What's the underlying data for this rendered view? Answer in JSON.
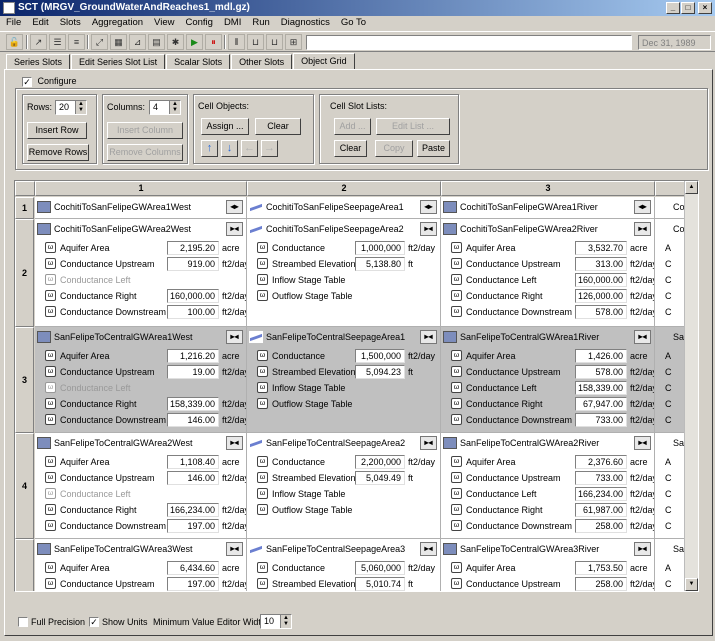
{
  "window": {
    "title": "SCT  (MRGV_GroundWaterAndReaches1_mdl.gz)",
    "min": "_",
    "max": "□",
    "close": "×"
  },
  "menu": [
    "File",
    "Edit",
    "Slots",
    "Aggregation",
    "View",
    "Config",
    "DMI",
    "Run",
    "Diagnostics",
    "Go To"
  ],
  "toolbar": {
    "date": "Dec 31, 1989"
  },
  "tabs": [
    "Series Slots",
    "Edit Series Slot List",
    "Scalar Slots",
    "Other Slots",
    "Object Grid"
  ],
  "configure": {
    "label": "Configure",
    "checked": true,
    "rows_label": "Rows:",
    "rows_value": "20",
    "insert_row": "Insert Row",
    "remove_rows": "Remove Rows",
    "columns_label": "Columns:",
    "columns_value": "4",
    "insert_column": "Insert Column",
    "remove_columns": "Remove Columns",
    "cell_objects_label": "Cell Objects:",
    "assign": "Assign ...",
    "clear": "Clear",
    "cell_slot_lists_label": "Cell Slot Lists:",
    "add": "Add ...",
    "edit_list": "Edit List ...",
    "clear2": "Clear",
    "copy": "Copy",
    "paste": "Paste"
  },
  "grid": {
    "columns": [
      "1",
      "2",
      "3"
    ],
    "rows": [
      "1",
      "2",
      "3",
      "4"
    ],
    "cells": [
      [
        {
          "name": "CochitiToSanFelipeGWArea1West",
          "type": "gw",
          "slots": []
        },
        {
          "name": "CochitiToSanFelipeSeepageArea1",
          "type": "sp",
          "slots": []
        },
        {
          "name": "CochitiToSanFelipeGWArea1River",
          "type": "gw",
          "slots": []
        }
      ],
      [
        {
          "name": "CochitiToSanFelipeGWArea2West",
          "type": "gw",
          "slots": [
            {
              "name": "Aquifer Area",
              "value": "2,195.20",
              "unit": "acre"
            },
            {
              "name": "Conductance Upstream",
              "value": "919.00",
              "unit": "ft2/day"
            },
            {
              "name": "Conductance Left",
              "value": "",
              "unit": "",
              "disabled": true
            },
            {
              "name": "Conductance Right",
              "value": "160,000.00",
              "unit": "ft2/day"
            },
            {
              "name": "Conductance Downstream",
              "value": "100.00",
              "unit": "ft2/day"
            }
          ]
        },
        {
          "name": "CochitiToSanFelipeSeepageArea2",
          "type": "sp",
          "slots": [
            {
              "name": "Conductance",
              "value": "1,000,000",
              "unit": "ft2/day"
            },
            {
              "name": "Streambed Elevation",
              "value": "5,138.80",
              "unit": "ft"
            },
            {
              "name": "Inflow Stage Table",
              "value": "",
              "unit": ""
            },
            {
              "name": "Outflow Stage Table",
              "value": "",
              "unit": ""
            }
          ]
        },
        {
          "name": "CochitiToSanFelipeGWArea2River",
          "type": "gw",
          "slots": [
            {
              "name": "Aquifer Area",
              "value": "3,532.70",
              "unit": "acre"
            },
            {
              "name": "Conductance Upstream",
              "value": "313.00",
              "unit": "ft2/day"
            },
            {
              "name": "Conductance Left",
              "value": "160,000.00",
              "unit": "ft2/day"
            },
            {
              "name": "Conductance Right",
              "value": "126,000.00",
              "unit": "ft2/day"
            },
            {
              "name": "Conductance Downstream",
              "value": "578.00",
              "unit": "ft2/day"
            }
          ]
        }
      ],
      [
        {
          "name": "SanFelipeToCentralGWArea1West",
          "type": "gw",
          "slots": [
            {
              "name": "Aquifer Area",
              "value": "1,216.20",
              "unit": "acre"
            },
            {
              "name": "Conductance Upstream",
              "value": "19.00",
              "unit": "ft2/day"
            },
            {
              "name": "Conductance Left",
              "value": "",
              "unit": "",
              "disabled": true
            },
            {
              "name": "Conductance Right",
              "value": "158,339.00",
              "unit": "ft2/day"
            },
            {
              "name": "Conductance Downstream",
              "value": "146.00",
              "unit": "ft2/day"
            }
          ]
        },
        {
          "name": "SanFelipeToCentralSeepageArea1",
          "type": "sp",
          "slots": [
            {
              "name": "Conductance",
              "value": "1,500,000",
              "unit": "ft2/day"
            },
            {
              "name": "Streambed Elevation",
              "value": "5,094.23",
              "unit": "ft"
            },
            {
              "name": "Inflow Stage Table",
              "value": "",
              "unit": ""
            },
            {
              "name": "Outflow Stage Table",
              "value": "",
              "unit": ""
            }
          ]
        },
        {
          "name": "SanFelipeToCentralGWArea1River",
          "type": "gw",
          "slots": [
            {
              "name": "Aquifer Area",
              "value": "1,426.00",
              "unit": "acre"
            },
            {
              "name": "Conductance Upstream",
              "value": "578.00",
              "unit": "ft2/day"
            },
            {
              "name": "Conductance Left",
              "value": "158,339.00",
              "unit": "ft2/day"
            },
            {
              "name": "Conductance Right",
              "value": "67,947.00",
              "unit": "ft2/day"
            },
            {
              "name": "Conductance Downstream",
              "value": "733.00",
              "unit": "ft2/day"
            }
          ]
        }
      ],
      [
        {
          "name": "SanFelipeToCentralGWArea2West",
          "type": "gw",
          "slots": [
            {
              "name": "Aquifer Area",
              "value": "1,108.40",
              "unit": "acre"
            },
            {
              "name": "Conductance Upstream",
              "value": "146.00",
              "unit": "ft2/day"
            },
            {
              "name": "Conductance Left",
              "value": "",
              "unit": "",
              "disabled": true
            },
            {
              "name": "Conductance Right",
              "value": "166,234.00",
              "unit": "ft2/day"
            },
            {
              "name": "Conductance Downstream",
              "value": "197.00",
              "unit": "ft2/day"
            }
          ]
        },
        {
          "name": "SanFelipeToCentralSeepageArea2",
          "type": "sp",
          "slots": [
            {
              "name": "Conductance",
              "value": "2,200,000",
              "unit": "ft2/day"
            },
            {
              "name": "Streambed Elevation",
              "value": "5,049.49",
              "unit": "ft"
            },
            {
              "name": "Inflow Stage Table",
              "value": "",
              "unit": ""
            },
            {
              "name": "Outflow Stage Table",
              "value": "",
              "unit": ""
            }
          ]
        },
        {
          "name": "SanFelipeToCentralGWArea2River",
          "type": "gw",
          "slots": [
            {
              "name": "Aquifer Area",
              "value": "2,376.60",
              "unit": "acre"
            },
            {
              "name": "Conductance Upstream",
              "value": "733.00",
              "unit": "ft2/day"
            },
            {
              "name": "Conductance Left",
              "value": "166,234.00",
              "unit": "ft2/day"
            },
            {
              "name": "Conductance Right",
              "value": "61,987.00",
              "unit": "ft2/day"
            },
            {
              "name": "Conductance Downstream",
              "value": "258.00",
              "unit": "ft2/day"
            }
          ]
        }
      ],
      [
        {
          "name": "SanFelipeToCentralGWArea3West",
          "type": "gw",
          "slots": [
            {
              "name": "Aquifer Area",
              "value": "6,434.60",
              "unit": "acre"
            },
            {
              "name": "Conductance Upstream",
              "value": "197.00",
              "unit": "ft2/day"
            }
          ]
        },
        {
          "name": "SanFelipeToCentralSeepageArea3",
          "type": "sp",
          "slots": [
            {
              "name": "Conductance",
              "value": "5,060,000",
              "unit": "ft2/day"
            },
            {
              "name": "Streambed Elevation",
              "value": "5,010.74",
              "unit": "ft"
            }
          ]
        },
        {
          "name": "SanFelipeToCentralGWArea3River",
          "type": "gw",
          "slots": [
            {
              "name": "Aquifer Area",
              "value": "1,753.50",
              "unit": "acre"
            },
            {
              "name": "Conductance Upstream",
              "value": "258.00",
              "unit": "ft2/day"
            }
          ]
        }
      ]
    ],
    "col4_stub": [
      "Co",
      "Co",
      "A",
      "C",
      "C",
      "C",
      "C",
      "Sa",
      "A",
      "C",
      "C",
      "C",
      "C",
      "Sa",
      "A",
      "C",
      "C",
      "C",
      "C",
      "Sa",
      "A",
      "C"
    ]
  },
  "bottom": {
    "full_precision": "Full Precision",
    "show_units": "Show Units",
    "min_width_label": "Minimum Value Editor Width:",
    "min_width_value": "10"
  }
}
